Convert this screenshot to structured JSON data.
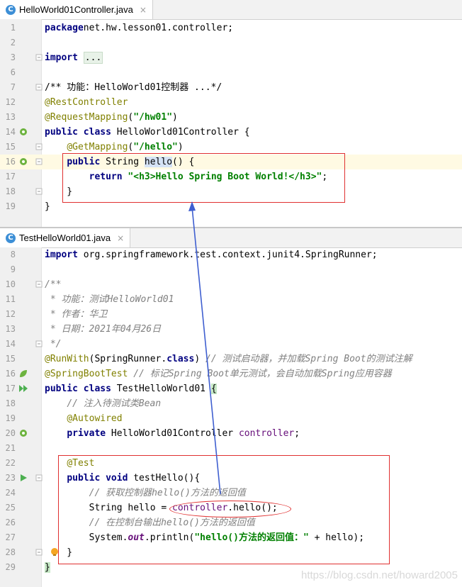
{
  "editor1": {
    "tab": {
      "label": "HelloWorld01Controller.java",
      "icon": "C",
      "close": "×"
    },
    "lines": [
      {
        "n": "1",
        "parts": [
          [
            "kw",
            "package"
          ],
          [
            "",
            "net.hw.lesson01.controller;"
          ]
        ]
      },
      {
        "n": "2",
        "parts": []
      },
      {
        "n": "3",
        "parts": [
          [
            "kw",
            "import"
          ],
          [
            "",
            " "
          ],
          [
            "fold-ph",
            "..."
          ]
        ]
      },
      {
        "n": "6",
        "parts": []
      },
      {
        "n": "7",
        "parts": [
          [
            "cm-plain",
            "/** 功能：HelloWorld01控制器 ...*/"
          ]
        ]
      },
      {
        "n": "12",
        "parts": [
          [
            "ann",
            "@RestController"
          ]
        ]
      },
      {
        "n": "13",
        "parts": [
          [
            "ann",
            "@RequestMapping"
          ],
          [
            "",
            "("
          ],
          [
            "str",
            "\"/hw01\""
          ],
          [
            "",
            ")"
          ]
        ]
      },
      {
        "n": "14",
        "parts": [
          [
            "kw",
            "public class"
          ],
          [
            "",
            " HelloWorld01Controller {"
          ]
        ]
      },
      {
        "n": "15",
        "parts": [
          [
            "",
            "    "
          ],
          [
            "ann",
            "@GetMapping"
          ],
          [
            "",
            "("
          ],
          [
            "str",
            "\"/hello\""
          ],
          [
            "",
            ")"
          ]
        ]
      },
      {
        "n": "16",
        "parts": [
          [
            "",
            "    "
          ],
          [
            "kw",
            "public"
          ],
          [
            "",
            " String "
          ],
          [
            "hl-word",
            "hello"
          ],
          [
            "",
            "() {"
          ]
        ]
      },
      {
        "n": "17",
        "parts": [
          [
            "",
            "        "
          ],
          [
            "kw",
            "return"
          ],
          [
            "",
            " "
          ],
          [
            "str",
            "\"<h3>Hello Spring Boot World!</h3>\""
          ],
          [
            "",
            ";"
          ]
        ]
      },
      {
        "n": "18",
        "parts": [
          [
            "",
            "    }"
          ]
        ]
      },
      {
        "n": "19",
        "parts": [
          [
            "",
            "}"
          ]
        ]
      }
    ]
  },
  "editor2": {
    "tab": {
      "label": "TestHelloWorld01.java",
      "icon": "C",
      "close": "×"
    },
    "lines": [
      {
        "n": "8",
        "parts": [
          [
            "kw",
            "import"
          ],
          [
            "",
            " org.springframework.test.context.junit4.SpringRunner;"
          ]
        ]
      },
      {
        "n": "9",
        "parts": []
      },
      {
        "n": "10",
        "parts": [
          [
            "cm",
            "/**"
          ]
        ]
      },
      {
        "n": "11",
        "parts": [
          [
            "cm",
            " * 功能：测试HelloWorld01"
          ]
        ]
      },
      {
        "n": "12",
        "parts": [
          [
            "cm",
            " * 作者：华卫"
          ]
        ]
      },
      {
        "n": "13",
        "parts": [
          [
            "cm",
            " * 日期：2021年04月26日"
          ]
        ]
      },
      {
        "n": "14",
        "parts": [
          [
            "cm",
            " */"
          ]
        ]
      },
      {
        "n": "15",
        "parts": [
          [
            "ann",
            "@RunWith"
          ],
          [
            "",
            "(SpringRunner."
          ],
          [
            "kw",
            "class"
          ],
          [
            "",
            ") "
          ],
          [
            "cm",
            "// 测试启动器，并加载Spring Boot的测试注解"
          ]
        ]
      },
      {
        "n": "16",
        "parts": [
          [
            "ann",
            "@SpringBootTest"
          ],
          [
            "",
            " "
          ],
          [
            "cm",
            "// 标记Spring Boot单元测试，会自动加载Spring应用容器"
          ]
        ]
      },
      {
        "n": "17",
        "parts": [
          [
            "kw",
            "public class"
          ],
          [
            "",
            " TestHelloWorld01 "
          ],
          [
            "hl-brace",
            "{"
          ]
        ]
      },
      {
        "n": "18",
        "parts": [
          [
            "",
            "    "
          ],
          [
            "cm",
            "// 注入待测试类Bean"
          ]
        ]
      },
      {
        "n": "19",
        "parts": [
          [
            "",
            "    "
          ],
          [
            "ann",
            "@Autowired"
          ]
        ]
      },
      {
        "n": "20",
        "parts": [
          [
            "",
            "    "
          ],
          [
            "kw",
            "private"
          ],
          [
            "",
            " HelloWorld01Controller "
          ],
          [
            "fld",
            "controller"
          ],
          [
            "",
            ";"
          ]
        ]
      },
      {
        "n": "21",
        "parts": []
      },
      {
        "n": "22",
        "parts": [
          [
            "",
            "    "
          ],
          [
            "ann",
            "@Test"
          ]
        ]
      },
      {
        "n": "23",
        "parts": [
          [
            "",
            "    "
          ],
          [
            "kw",
            "public void"
          ],
          [
            "",
            " testHello(){"
          ]
        ]
      },
      {
        "n": "24",
        "parts": [
          [
            "",
            "        "
          ],
          [
            "cm",
            "// 获取控制器hello()方法的返回值"
          ]
        ]
      },
      {
        "n": "25",
        "parts": [
          [
            "",
            "        String hello = "
          ],
          [
            "fld",
            "controller"
          ],
          [
            "",
            ".hello();"
          ]
        ]
      },
      {
        "n": "26",
        "parts": [
          [
            "",
            "        "
          ],
          [
            "cm",
            "// 在控制台输出hello()方法的返回值"
          ]
        ]
      },
      {
        "n": "27",
        "parts": [
          [
            "",
            "        System."
          ],
          [
            "itfld",
            "out"
          ],
          [
            "",
            ".println("
          ],
          [
            "str",
            "\"hello()方法的返回值：\""
          ],
          [
            "",
            " + hello);"
          ]
        ]
      },
      {
        "n": "28",
        "parts": [
          [
            "",
            "    }"
          ]
        ]
      },
      {
        "n": "29",
        "parts": [
          [
            "hl-brace",
            "}"
          ]
        ]
      }
    ]
  },
  "watermark": "https://blog.csdn.net/howard2005",
  "colors": {
    "annotation_box": "#e03030",
    "arrow": "#3f5fd0"
  }
}
